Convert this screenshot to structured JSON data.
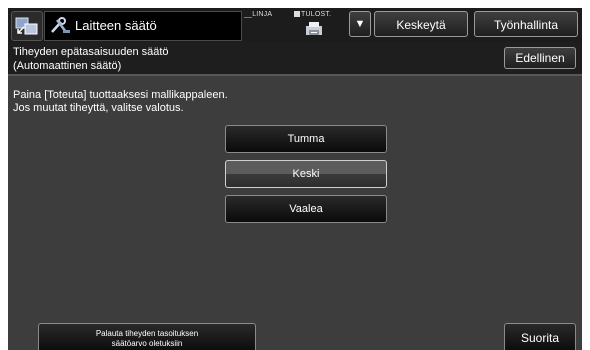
{
  "topbar": {
    "title": "Laitteen säätö",
    "status_linja": "LINJA",
    "status_tulost": "TULOST.",
    "dropdown_glyph": "▼",
    "pause_label": "Keskeytä",
    "job_label": "Työnhallinta"
  },
  "header": {
    "line1": "Tiheyden epätasaisuuden säätö",
    "line2": "(Automaattinen säätö)",
    "previous_label": "Edellinen"
  },
  "body": {
    "instruction_line1": "Paina [Toteuta] tuottaaksesi mallikappaleen.",
    "instruction_line2": "Jos muutat tiheyttä, valitse valotus.",
    "options": [
      {
        "label": "Tumma",
        "selected": false
      },
      {
        "label": "Keski",
        "selected": true
      },
      {
        "label": "Vaalea",
        "selected": false
      }
    ]
  },
  "footer": {
    "reset_line1": "Palauta tiheyden tasoituksen",
    "reset_line2": "säätöarvo oletuksiin",
    "run_label": "Suorita"
  },
  "icons": {
    "home": "home-icon",
    "tools": "tools-icon",
    "printer": "printer-icon",
    "dropdown": "triangle-down-icon"
  },
  "colors": {
    "background": "#3d3d3d",
    "bar": "#1c1c1c",
    "text": "#ffffff",
    "selected_button": "#5c5c5c"
  }
}
